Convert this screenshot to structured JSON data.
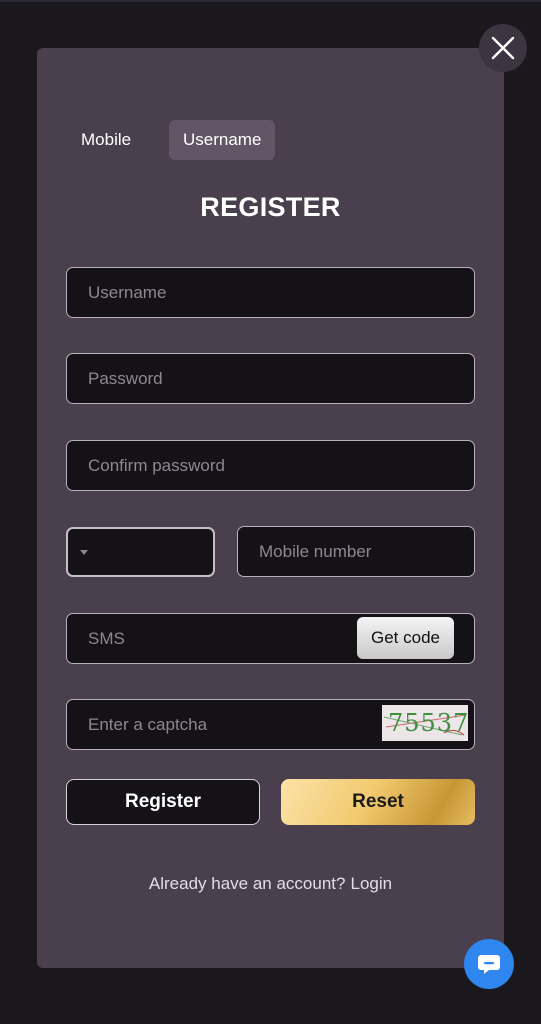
{
  "tabs": {
    "mobile": "Mobile",
    "username": "Username"
  },
  "title": "REGISTER",
  "fields": {
    "username_placeholder": "Username",
    "password_placeholder": "Password",
    "confirm_password_placeholder": "Confirm password",
    "mobile_placeholder": "Mobile number",
    "sms_placeholder": "SMS",
    "captcha_placeholder": "Enter a captcha"
  },
  "get_code_label": "Get code",
  "captcha_text": "75537",
  "buttons": {
    "register": "Register",
    "reset": "Reset"
  },
  "footer": {
    "text": "Already have an account?",
    "login": "Login"
  },
  "colors": {
    "modal_bg": "#4a3f4d",
    "field_bg": "#141216",
    "accent_gold": "#f2c96e",
    "chat_blue": "#2f86ef"
  },
  "icons": {
    "close": "close-icon",
    "chat": "chat-icon",
    "dropdown": "caret-down-icon"
  }
}
